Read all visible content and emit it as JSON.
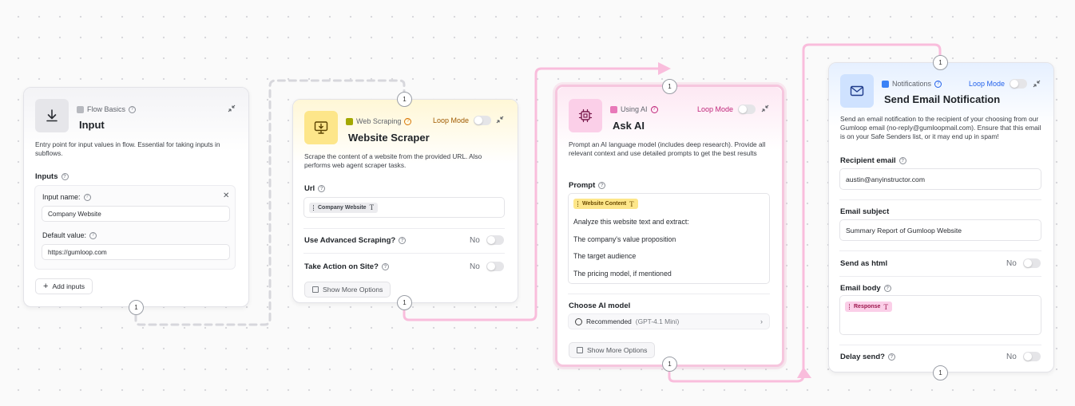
{
  "colors": {
    "background": "#fafafa",
    "connector_dashed": "#d7d7dc",
    "connector_active": "#f9bddc",
    "ai_border": "#f6c6de",
    "loop_yellow": "#a05a00",
    "loop_pink": "#c0267a",
    "loop_blue": "#2563eb"
  },
  "nodes": {
    "input": {
      "category": "Flow Basics",
      "title": "Input",
      "icon": "download-icon",
      "description": "Entry point for input values in flow. Essential for taking inputs in subflows.",
      "inputs_label": "Inputs",
      "input_name_label": "Input name:",
      "input_name_value": "Company Website",
      "default_value_label": "Default value:",
      "default_value": "https://gumloop.com",
      "add_inputs": "Add inputs",
      "port_count": "1"
    },
    "scraper": {
      "category": "Web Scraping",
      "title": "Website Scraper",
      "icon": "monitor-download-icon",
      "loop_mode": "Loop Mode",
      "description": "Scrape the content of a website from the provided URL. Also performs web agent scraper tasks.",
      "url_label": "Url",
      "url_chip": "Company Website",
      "advanced_label": "Use Advanced Scraping?",
      "advanced_value": "No",
      "action_label": "Take Action on Site?",
      "action_value": "No",
      "more_options": "Show More Options",
      "port_in": "1",
      "port_out": "1"
    },
    "ask_ai": {
      "category": "Using AI",
      "title": "Ask AI",
      "icon": "cpu-chip-icon",
      "loop_mode": "Loop Mode",
      "description": "Prompt an AI language model (includes deep research). Provide all relevant context and use detailed prompts to get the best results",
      "prompt_label": "Prompt",
      "prompt_chip": "Website Content",
      "prompt_lines": [
        "Analyze this website text and extract:",
        "The company's value proposition",
        "The target audience",
        "The pricing model, if mentioned"
      ],
      "model_label": "Choose AI model",
      "model_value": "Recommended",
      "model_sub": "(GPT-4.1 Mini)",
      "more_options": "Show More Options",
      "port_in": "1",
      "port_out": "1"
    },
    "email": {
      "category": "Notifications",
      "title": "Send Email Notification",
      "icon": "mail-icon",
      "loop_mode": "Loop Mode",
      "description": "Send an email notification to the recipient of your choosing from our Gumloop email (no-reply@gumloopmail.com). Ensure that this email is on your Safe Senders list, or it may end up in spam!",
      "recipient_label": "Recipient email",
      "recipient_value": "austin@anyinstructor.com",
      "subject_label": "Email subject",
      "subject_value": "Summary Report of Gumloop Website",
      "html_label": "Send as html",
      "html_value": "No",
      "body_label": "Email body",
      "body_chip": "Response",
      "delay_label": "Delay send?",
      "delay_value": "No",
      "port_in": "1",
      "port_out": "1"
    }
  }
}
